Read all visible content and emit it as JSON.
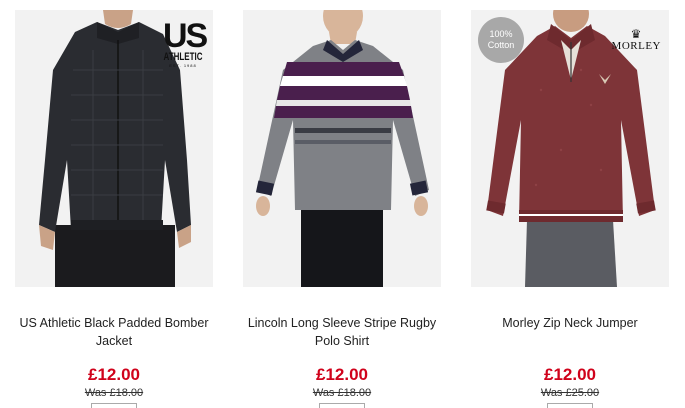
{
  "products": [
    {
      "name": "US Athletic Black Padded Bomber Jacket",
      "price": "£12.00",
      "was_price": "Was £18.00",
      "brand_badge": {
        "big": "US",
        "small": "ATHLETIC",
        "tag": "EST. 1988"
      },
      "image_icon": "black-padded-jacket"
    },
    {
      "name": "Lincoln Long Sleeve Stripe Rugby Polo Shirt",
      "price": "£12.00",
      "was_price": "Was £18.00",
      "image_icon": "striped-rugby-polo"
    },
    {
      "name": "Morley Zip Neck Jumper",
      "price": "£12.00",
      "was_price": "Was £25.00",
      "cotton_badge": {
        "line1": "100%",
        "line2": "Cotton"
      },
      "brand_badge": {
        "mark": "♛",
        "name": "MORLEY"
      },
      "image_icon": "burgundy-zip-jumper"
    }
  ],
  "colors": {
    "price": "#d0021b",
    "image_bg": "#f2f2f2",
    "cotton_badge": "#a8a8a8"
  }
}
